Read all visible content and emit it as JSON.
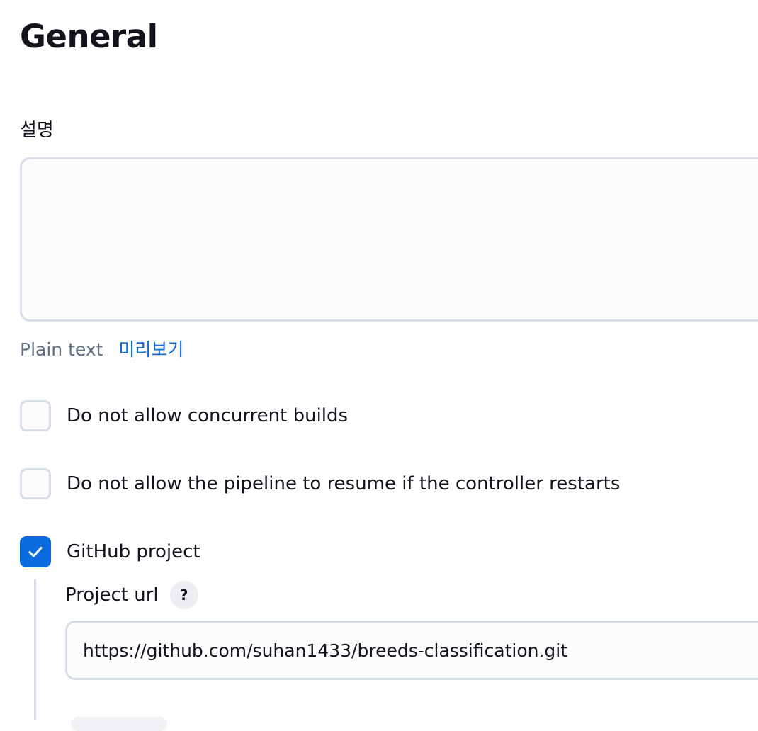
{
  "general": {
    "title": "General"
  },
  "description": {
    "label": "설명",
    "value": "",
    "format_label": "Plain text",
    "preview_link": "미리보기"
  },
  "options": [
    {
      "label": "Do not allow concurrent builds",
      "checked": false
    },
    {
      "label": "Do not allow the pipeline to resume if the controller restarts",
      "checked": false
    },
    {
      "label": "GitHub project",
      "checked": true
    }
  ],
  "github_project": {
    "url_label": "Project url",
    "help": "?",
    "url_value": "https://github.com/suhan1433/breeds-classification.git"
  },
  "colors": {
    "accent": "#0b6bdc",
    "border": "#d7dde8",
    "muted_text": "#5f6f85",
    "text": "#14141f"
  }
}
